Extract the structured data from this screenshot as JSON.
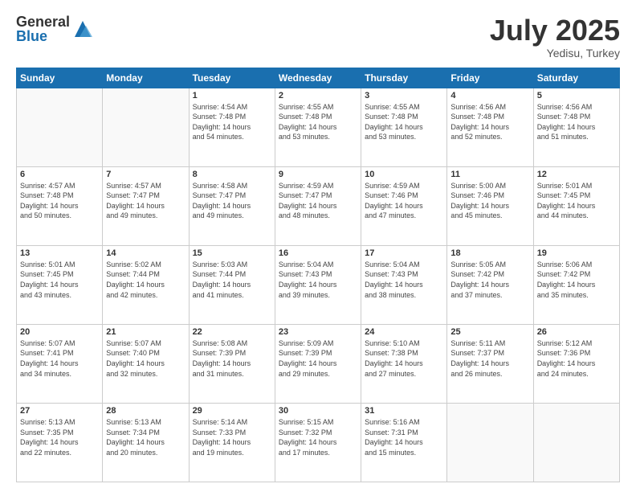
{
  "logo": {
    "general": "General",
    "blue": "Blue"
  },
  "title": {
    "month": "July 2025",
    "location": "Yedisu, Turkey"
  },
  "headers": [
    "Sunday",
    "Monday",
    "Tuesday",
    "Wednesday",
    "Thursday",
    "Friday",
    "Saturday"
  ],
  "weeks": [
    [
      {
        "day": "",
        "text": ""
      },
      {
        "day": "",
        "text": ""
      },
      {
        "day": "1",
        "text": "Sunrise: 4:54 AM\nSunset: 7:48 PM\nDaylight: 14 hours\nand 54 minutes."
      },
      {
        "day": "2",
        "text": "Sunrise: 4:55 AM\nSunset: 7:48 PM\nDaylight: 14 hours\nand 53 minutes."
      },
      {
        "day": "3",
        "text": "Sunrise: 4:55 AM\nSunset: 7:48 PM\nDaylight: 14 hours\nand 53 minutes."
      },
      {
        "day": "4",
        "text": "Sunrise: 4:56 AM\nSunset: 7:48 PM\nDaylight: 14 hours\nand 52 minutes."
      },
      {
        "day": "5",
        "text": "Sunrise: 4:56 AM\nSunset: 7:48 PM\nDaylight: 14 hours\nand 51 minutes."
      }
    ],
    [
      {
        "day": "6",
        "text": "Sunrise: 4:57 AM\nSunset: 7:48 PM\nDaylight: 14 hours\nand 50 minutes."
      },
      {
        "day": "7",
        "text": "Sunrise: 4:57 AM\nSunset: 7:47 PM\nDaylight: 14 hours\nand 49 minutes."
      },
      {
        "day": "8",
        "text": "Sunrise: 4:58 AM\nSunset: 7:47 PM\nDaylight: 14 hours\nand 49 minutes."
      },
      {
        "day": "9",
        "text": "Sunrise: 4:59 AM\nSunset: 7:47 PM\nDaylight: 14 hours\nand 48 minutes."
      },
      {
        "day": "10",
        "text": "Sunrise: 4:59 AM\nSunset: 7:46 PM\nDaylight: 14 hours\nand 47 minutes."
      },
      {
        "day": "11",
        "text": "Sunrise: 5:00 AM\nSunset: 7:46 PM\nDaylight: 14 hours\nand 45 minutes."
      },
      {
        "day": "12",
        "text": "Sunrise: 5:01 AM\nSunset: 7:45 PM\nDaylight: 14 hours\nand 44 minutes."
      }
    ],
    [
      {
        "day": "13",
        "text": "Sunrise: 5:01 AM\nSunset: 7:45 PM\nDaylight: 14 hours\nand 43 minutes."
      },
      {
        "day": "14",
        "text": "Sunrise: 5:02 AM\nSunset: 7:44 PM\nDaylight: 14 hours\nand 42 minutes."
      },
      {
        "day": "15",
        "text": "Sunrise: 5:03 AM\nSunset: 7:44 PM\nDaylight: 14 hours\nand 41 minutes."
      },
      {
        "day": "16",
        "text": "Sunrise: 5:04 AM\nSunset: 7:43 PM\nDaylight: 14 hours\nand 39 minutes."
      },
      {
        "day": "17",
        "text": "Sunrise: 5:04 AM\nSunset: 7:43 PM\nDaylight: 14 hours\nand 38 minutes."
      },
      {
        "day": "18",
        "text": "Sunrise: 5:05 AM\nSunset: 7:42 PM\nDaylight: 14 hours\nand 37 minutes."
      },
      {
        "day": "19",
        "text": "Sunrise: 5:06 AM\nSunset: 7:42 PM\nDaylight: 14 hours\nand 35 minutes."
      }
    ],
    [
      {
        "day": "20",
        "text": "Sunrise: 5:07 AM\nSunset: 7:41 PM\nDaylight: 14 hours\nand 34 minutes."
      },
      {
        "day": "21",
        "text": "Sunrise: 5:07 AM\nSunset: 7:40 PM\nDaylight: 14 hours\nand 32 minutes."
      },
      {
        "day": "22",
        "text": "Sunrise: 5:08 AM\nSunset: 7:39 PM\nDaylight: 14 hours\nand 31 minutes."
      },
      {
        "day": "23",
        "text": "Sunrise: 5:09 AM\nSunset: 7:39 PM\nDaylight: 14 hours\nand 29 minutes."
      },
      {
        "day": "24",
        "text": "Sunrise: 5:10 AM\nSunset: 7:38 PM\nDaylight: 14 hours\nand 27 minutes."
      },
      {
        "day": "25",
        "text": "Sunrise: 5:11 AM\nSunset: 7:37 PM\nDaylight: 14 hours\nand 26 minutes."
      },
      {
        "day": "26",
        "text": "Sunrise: 5:12 AM\nSunset: 7:36 PM\nDaylight: 14 hours\nand 24 minutes."
      }
    ],
    [
      {
        "day": "27",
        "text": "Sunrise: 5:13 AM\nSunset: 7:35 PM\nDaylight: 14 hours\nand 22 minutes."
      },
      {
        "day": "28",
        "text": "Sunrise: 5:13 AM\nSunset: 7:34 PM\nDaylight: 14 hours\nand 20 minutes."
      },
      {
        "day": "29",
        "text": "Sunrise: 5:14 AM\nSunset: 7:33 PM\nDaylight: 14 hours\nand 19 minutes."
      },
      {
        "day": "30",
        "text": "Sunrise: 5:15 AM\nSunset: 7:32 PM\nDaylight: 14 hours\nand 17 minutes."
      },
      {
        "day": "31",
        "text": "Sunrise: 5:16 AM\nSunset: 7:31 PM\nDaylight: 14 hours\nand 15 minutes."
      },
      {
        "day": "",
        "text": ""
      },
      {
        "day": "",
        "text": ""
      }
    ]
  ]
}
